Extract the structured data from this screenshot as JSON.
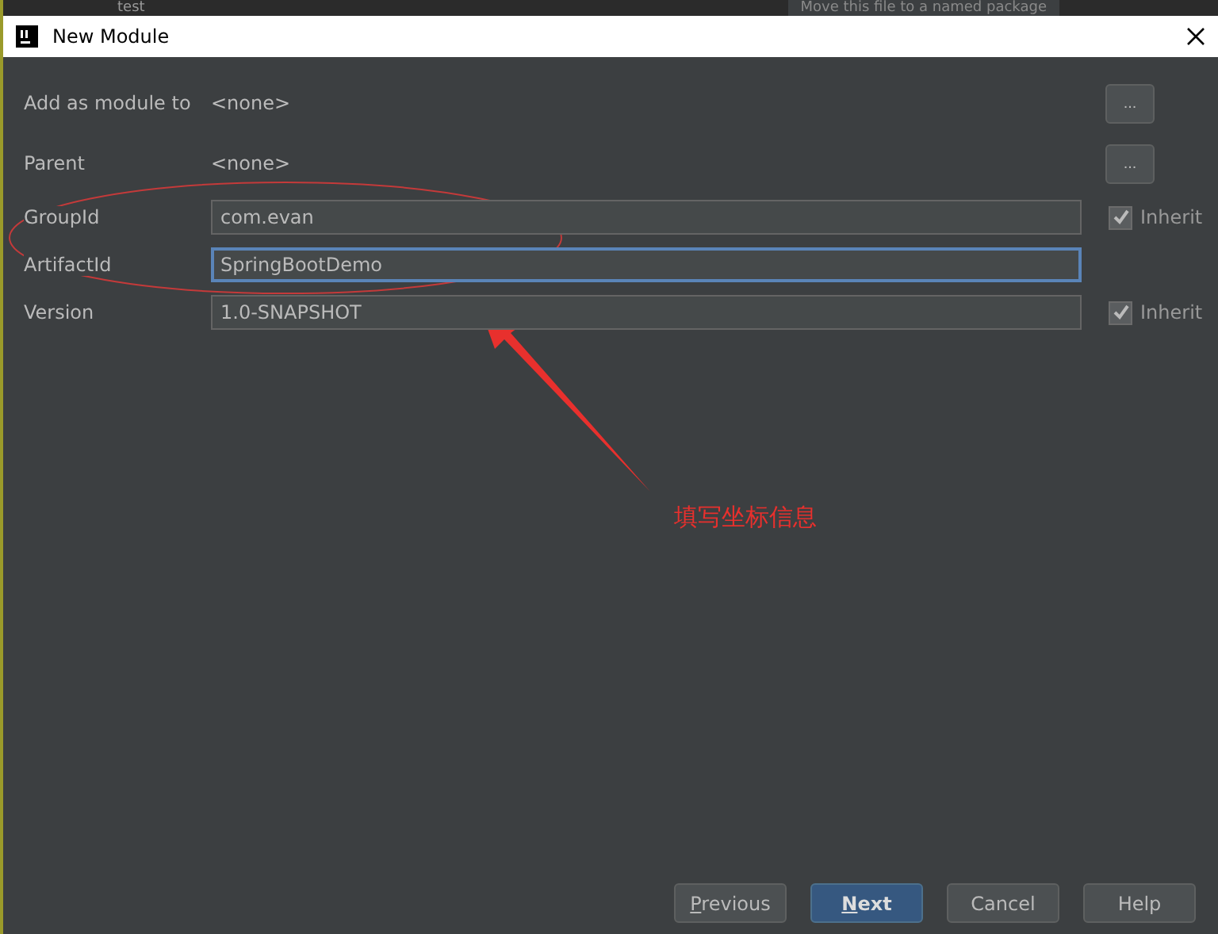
{
  "background": {
    "tree_item": "test",
    "hint": "Move this file to a named package"
  },
  "window": {
    "title": "New Module"
  },
  "fields": [
    {
      "kind": "selector",
      "label": "Add as module to",
      "value": "<none>",
      "button": "..."
    },
    {
      "kind": "selector",
      "label": "Parent",
      "value": "<none>",
      "button": "..."
    },
    {
      "kind": "input",
      "label": "GroupId",
      "value": "com.evan",
      "focused": false,
      "inherit": {
        "label": "Inherit",
        "checked": true
      }
    },
    {
      "kind": "input",
      "label": "ArtifactId",
      "value": "SpringBootDemo",
      "focused": true
    },
    {
      "kind": "input",
      "label": "Version",
      "value": "1.0-SNAPSHOT",
      "focused": false,
      "inherit": {
        "label": "Inherit",
        "checked": true
      }
    }
  ],
  "annotation": {
    "text": "填写坐标信息"
  },
  "buttons": [
    {
      "label": "Previous",
      "mnemonic": true,
      "default": false
    },
    {
      "label": "Next",
      "mnemonic": true,
      "default": true
    },
    {
      "label": "Cancel",
      "mnemonic": false,
      "default": false
    },
    {
      "label": "Help",
      "mnemonic": false,
      "default": false
    }
  ]
}
